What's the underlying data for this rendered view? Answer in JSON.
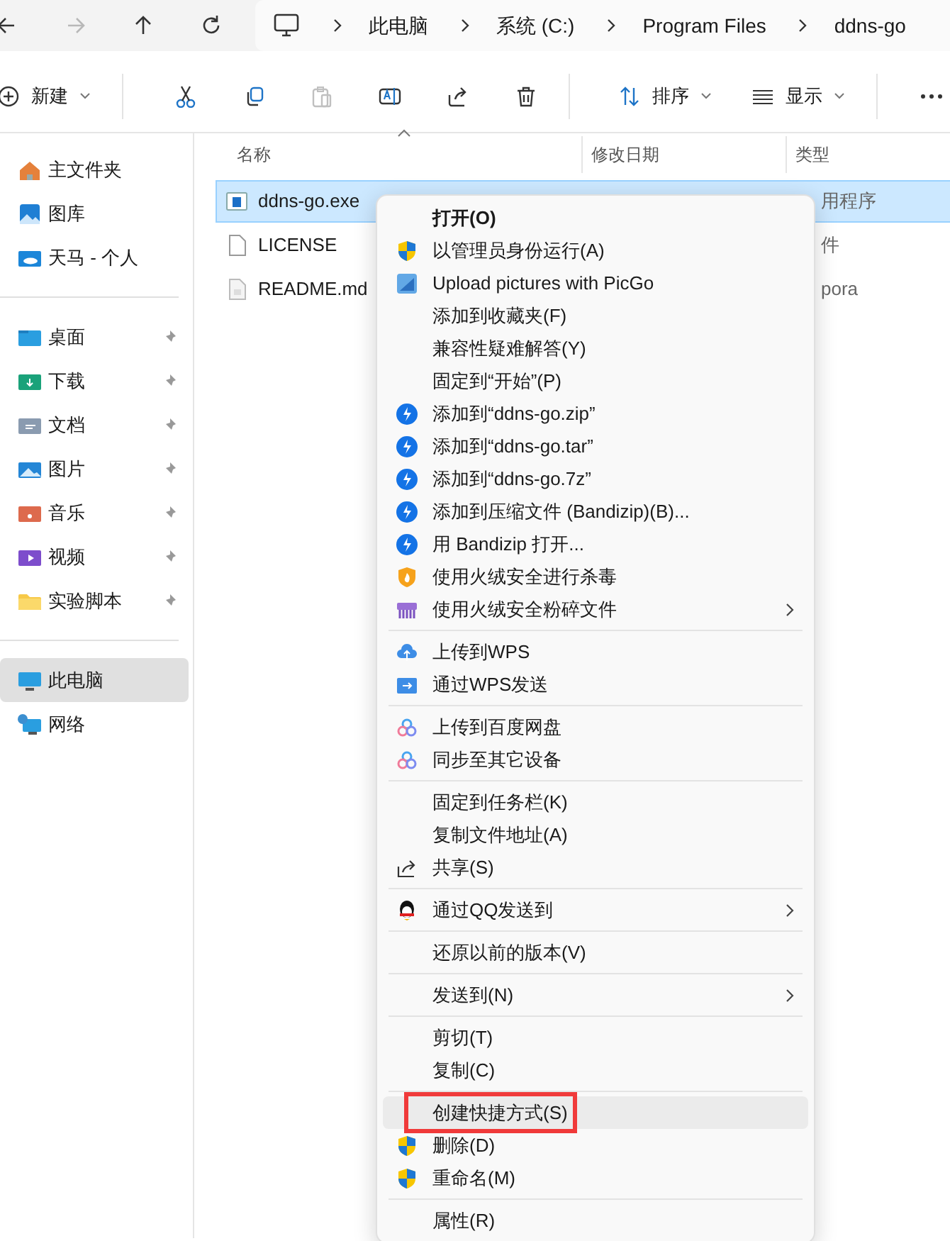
{
  "nav": {
    "buttons": [
      {
        "kind": "back",
        "disabled": false
      },
      {
        "kind": "forward",
        "disabled": true
      },
      {
        "kind": "up",
        "disabled": false
      },
      {
        "kind": "refresh",
        "disabled": false
      }
    ],
    "breadcrumbs": [
      "此电脑",
      "系统 (C:)",
      "Program Files",
      "ddns-go"
    ]
  },
  "toolbar": [
    {
      "kind": "new",
      "label": "新建",
      "disabled": false
    },
    {
      "kind": "cut",
      "disabled": false
    },
    {
      "kind": "copy",
      "disabled": false
    },
    {
      "kind": "paste",
      "disabled": true
    },
    {
      "kind": "rename",
      "disabled": false
    },
    {
      "kind": "share",
      "disabled": false
    },
    {
      "kind": "delete",
      "disabled": false
    },
    {
      "kind": "sort",
      "label": "排序",
      "disabled": false
    },
    {
      "kind": "view",
      "label": "显示",
      "disabled": false
    },
    {
      "kind": "more",
      "disabled": false
    }
  ],
  "sidebar": {
    "groups": [
      [
        {
          "label": "主文件夹",
          "pinned": false,
          "selected": false
        },
        {
          "label": "图库",
          "pinned": false,
          "selected": false
        },
        {
          "label": "天马 - 个人",
          "pinned": false,
          "selected": false
        }
      ],
      [
        {
          "label": "桌面",
          "pinned": true,
          "selected": false
        },
        {
          "label": "下载",
          "pinned": true,
          "selected": false
        },
        {
          "label": "文档",
          "pinned": true,
          "selected": false
        },
        {
          "label": "图片",
          "pinned": true,
          "selected": false
        },
        {
          "label": "音乐",
          "pinned": true,
          "selected": false
        },
        {
          "label": "视频",
          "pinned": true,
          "selected": false
        },
        {
          "label": "实验脚本",
          "pinned": true,
          "selected": false
        }
      ],
      [
        {
          "label": "此电脑",
          "pinned": false,
          "selected": true
        },
        {
          "label": "网络",
          "pinned": false,
          "selected": false
        }
      ]
    ]
  },
  "table": {
    "columns": [
      "名称",
      "修改日期",
      "类型"
    ],
    "rows": [
      {
        "name": "ddns-go.exe",
        "type": "用程序",
        "selected": true
      },
      {
        "name": "LICENSE",
        "type": "件",
        "selected": false
      },
      {
        "name": "README.md",
        "type": "pora",
        "selected": false
      }
    ]
  },
  "context_menu": {
    "groups": [
      [
        {
          "label": "打开(O)",
          "bold": true,
          "submenu": false,
          "selected": false,
          "outlined": false
        },
        {
          "label": "以管理员身份运行(A)",
          "bold": false,
          "submenu": false,
          "selected": false,
          "outlined": false
        },
        {
          "label": "Upload pictures with PicGo",
          "bold": false,
          "submenu": false,
          "selected": false,
          "outlined": false
        },
        {
          "label": "添加到收藏夹(F)",
          "bold": false,
          "submenu": false,
          "selected": false,
          "outlined": false
        },
        {
          "label": "兼容性疑难解答(Y)",
          "bold": false,
          "submenu": false,
          "selected": false,
          "outlined": false
        },
        {
          "label": "固定到“开始”(P)",
          "bold": false,
          "submenu": false,
          "selected": false,
          "outlined": false
        },
        {
          "label": "添加到“ddns-go.zip”",
          "bold": false,
          "submenu": false,
          "selected": false,
          "outlined": false
        },
        {
          "label": "添加到“ddns-go.tar”",
          "bold": false,
          "submenu": false,
          "selected": false,
          "outlined": false
        },
        {
          "label": "添加到“ddns-go.7z”",
          "bold": false,
          "submenu": false,
          "selected": false,
          "outlined": false
        },
        {
          "label": "添加到压缩文件 (Bandizip)(B)...",
          "bold": false,
          "submenu": false,
          "selected": false,
          "outlined": false
        },
        {
          "label": "用 Bandizip 打开...",
          "bold": false,
          "submenu": false,
          "selected": false,
          "outlined": false
        },
        {
          "label": "使用火绒安全进行杀毒",
          "bold": false,
          "submenu": false,
          "selected": false,
          "outlined": false
        },
        {
          "label": "使用火绒安全粉碎文件",
          "bold": false,
          "submenu": true,
          "selected": false,
          "outlined": false
        }
      ],
      [
        {
          "label": "上传到WPS",
          "bold": false,
          "submenu": false,
          "selected": false,
          "outlined": false
        },
        {
          "label": "通过WPS发送",
          "bold": false,
          "submenu": false,
          "selected": false,
          "outlined": false
        }
      ],
      [
        {
          "label": "上传到百度网盘",
          "bold": false,
          "submenu": false,
          "selected": false,
          "outlined": false
        },
        {
          "label": "同步至其它设备",
          "bold": false,
          "submenu": false,
          "selected": false,
          "outlined": false
        }
      ],
      [
        {
          "label": "固定到任务栏(K)",
          "bold": false,
          "submenu": false,
          "selected": false,
          "outlined": false
        },
        {
          "label": "复制文件地址(A)",
          "bold": false,
          "submenu": false,
          "selected": false,
          "outlined": false
        },
        {
          "label": "共享(S)",
          "bold": false,
          "submenu": false,
          "selected": false,
          "outlined": false
        }
      ],
      [
        {
          "label": "通过QQ发送到",
          "bold": false,
          "submenu": true,
          "selected": false,
          "outlined": false
        }
      ],
      [
        {
          "label": "还原以前的版本(V)",
          "bold": false,
          "submenu": false,
          "selected": false,
          "outlined": false
        }
      ],
      [
        {
          "label": "发送到(N)",
          "bold": false,
          "submenu": true,
          "selected": false,
          "outlined": false
        }
      ],
      [
        {
          "label": "剪切(T)",
          "bold": false,
          "submenu": false,
          "selected": false,
          "outlined": false
        },
        {
          "label": "复制(C)",
          "bold": false,
          "submenu": false,
          "selected": false,
          "outlined": false
        }
      ],
      [
        {
          "label": "创建快捷方式(S)",
          "bold": false,
          "submenu": false,
          "selected": true,
          "outlined": true
        },
        {
          "label": "删除(D)",
          "bold": false,
          "submenu": false,
          "selected": false,
          "outlined": false
        },
        {
          "label": "重命名(M)",
          "bold": false,
          "submenu": false,
          "selected": false,
          "outlined": false
        }
      ],
      [
        {
          "label": "属性(R)",
          "bold": false,
          "submenu": false,
          "selected": false,
          "outlined": false
        }
      ]
    ]
  }
}
